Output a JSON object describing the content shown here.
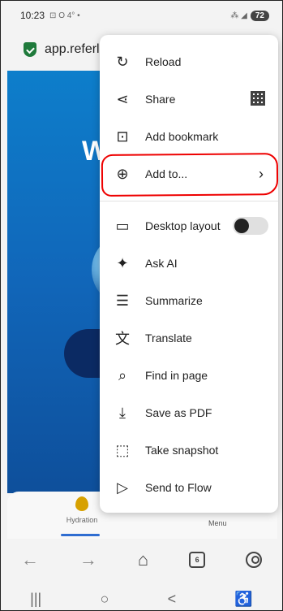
{
  "status": {
    "time": "10:23",
    "left_extra": "⊡ O 4° •",
    "signal": "⁂ ◢",
    "battery": "72"
  },
  "url": {
    "host": "app.referl"
  },
  "page": {
    "title_fragment": "W"
  },
  "app_nav": {
    "hydration": "Hydration",
    "menu": "Menu"
  },
  "browser_bar": {
    "back": "←",
    "forward": "→",
    "home": "⌂",
    "tabs_count": "6",
    "profile": ""
  },
  "system_nav": {
    "recents": "|||",
    "home": "○",
    "back": "<",
    "accessibility": "⽊"
  },
  "menu": {
    "items": [
      {
        "label": "Reload",
        "icon": "reload-icon"
      },
      {
        "label": "Share",
        "icon": "share-icon"
      },
      {
        "label": "Add bookmark",
        "icon": "bookmark-add-icon"
      },
      {
        "label": "Add to...",
        "icon": "plus-circle-icon"
      },
      {
        "label": "Desktop layout",
        "icon": "monitor-icon"
      },
      {
        "label": "Ask AI",
        "icon": "sparkle-icon"
      },
      {
        "label": "Summarize",
        "icon": "summarize-icon"
      },
      {
        "label": "Translate",
        "icon": "translate-icon"
      },
      {
        "label": "Find in page",
        "icon": "find-in-page-icon"
      },
      {
        "label": "Save as PDF",
        "icon": "download-icon"
      },
      {
        "label": "Take snapshot",
        "icon": "snapshot-icon"
      },
      {
        "label": "Send to Flow",
        "icon": "send-icon"
      }
    ],
    "desktop_layout_on": false
  }
}
